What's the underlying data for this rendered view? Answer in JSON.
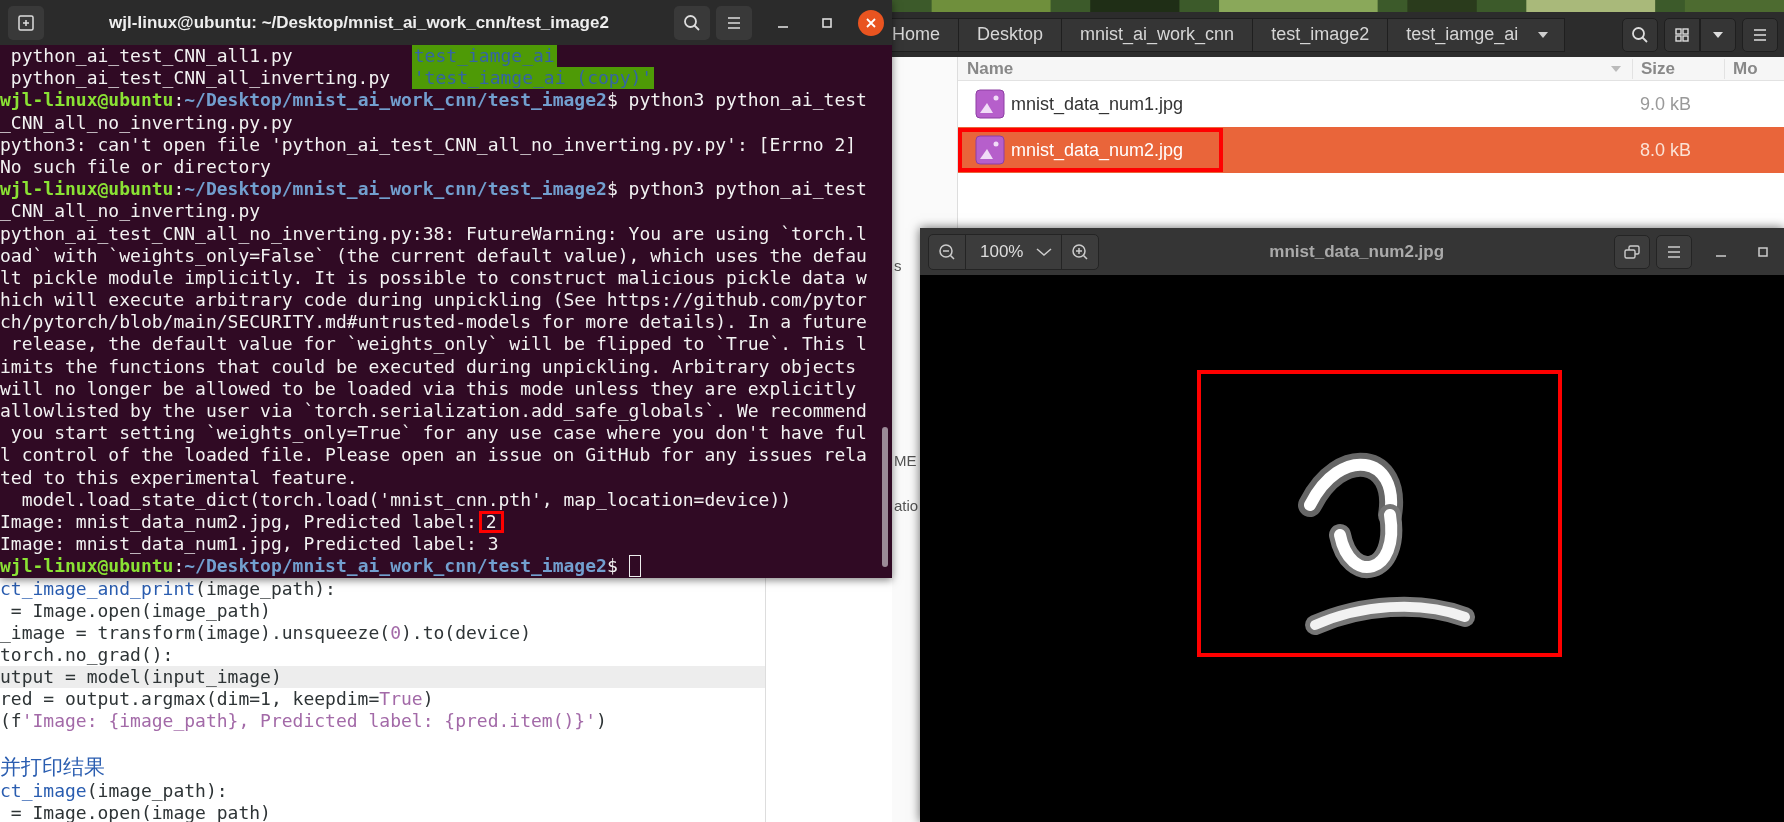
{
  "terminal": {
    "title": "wjl-linux@ubuntu: ~/Desktop/mnist_ai_work_cnn/test_image2",
    "lines": [
      {
        "kind": "ls",
        "file": "python_ai_test_CNN_all1.py",
        "dir": "test_iamge_ai"
      },
      {
        "kind": "ls",
        "file": "python_ai_test_CNN_all_inverting.py",
        "dir": "'test_iamge_ai (copy)'"
      },
      {
        "kind": "prompt",
        "user": "wjl-linux@ubuntu",
        "separator": ":",
        "path": "~/Desktop/mnist_ai_work_cnn/test_image2",
        "sign": "$",
        "command": "python3 python_ai_test",
        "cursor": false
      },
      {
        "kind": "output",
        "text": "_CNN_all_no_inverting.py.py"
      },
      {
        "kind": "output",
        "text": "python3: can't open file 'python_ai_test_CNN_all_no_inverting.py.py': [Errno 2]"
      },
      {
        "kind": "output",
        "text": "No such file or directory"
      },
      {
        "kind": "prompt",
        "user": "wjl-linux@ubuntu",
        "separator": ":",
        "path": "~/Desktop/mnist_ai_work_cnn/test_image2",
        "sign": "$",
        "command": "python3 python_ai_test",
        "cursor": false
      },
      {
        "kind": "output",
        "text": "_CNN_all_no_inverting.py"
      },
      {
        "kind": "output",
        "text": "python_ai_test_CNN_all_no_inverting.py:38: FutureWarning: You are using `torch.l"
      },
      {
        "kind": "output",
        "text": "oad` with `weights_only=False` (the current default value), which uses the defau"
      },
      {
        "kind": "output",
        "text": "lt pickle module implicitly. It is possible to construct malicious pickle data w"
      },
      {
        "kind": "output",
        "text": "hich will execute arbitrary code during unpickling (See https://github.com/pytor"
      },
      {
        "kind": "output",
        "text": "ch/pytorch/blob/main/SECURITY.md#untrusted-models for more details). In a future"
      },
      {
        "kind": "output",
        "text": " release, the default value for `weights_only` will be flipped to `True`. This l"
      },
      {
        "kind": "output",
        "text": "imits the functions that could be executed during unpickling. Arbitrary objects"
      },
      {
        "kind": "output",
        "text": "will no longer be allowed to be loaded via this mode unless they are explicitly"
      },
      {
        "kind": "output",
        "text": "allowlisted by the user via `torch.serialization.add_safe_globals`. We recommend"
      },
      {
        "kind": "output",
        "text": " you start setting `weights_only=True` for any use case where you don't have ful"
      },
      {
        "kind": "output",
        "text": "l control of the loaded file. Please open an issue on GitHub for any issues rela"
      },
      {
        "kind": "output",
        "text": "ted to this experimental feature."
      },
      {
        "kind": "output",
        "text": "  model.load_state_dict(torch.load('mnist_cnn.pth', map_location=device))"
      },
      {
        "kind": "output",
        "text": "Image: mnist_data_num2.jpg, Predicted label:",
        "marked": "2"
      },
      {
        "kind": "output",
        "text": "Image: mnist_data_num1.jpg, Predicted label: 3"
      },
      {
        "kind": "prompt",
        "user": "wjl-linux@ubuntu",
        "separator": ":",
        "path": "~/Desktop/mnist_ai_work_cnn/test_image2",
        "sign": "$",
        "cursor": true
      }
    ]
  },
  "editor": {
    "lines": [
      {
        "kind": "code",
        "current": false,
        "tokens": [
          {
            "text": "ct_image_and_print",
            "kind": "func"
          },
          {
            "text": "(image_path):",
            "kind": "plain"
          }
        ]
      },
      {
        "kind": "code",
        "current": false,
        "tokens": [
          {
            "text": " = Image.open(image_path)",
            "kind": "plain"
          }
        ]
      },
      {
        "kind": "code",
        "current": false,
        "tokens": [
          {
            "text": "_image = transform(image).unsqueeze(",
            "kind": "plain"
          },
          {
            "text": "0",
            "kind": "literal"
          },
          {
            "text": ").to(device)",
            "kind": "plain"
          }
        ]
      },
      {
        "kind": "code",
        "current": false,
        "tokens": [
          {
            "text": "torch.no_grad():",
            "kind": "plain"
          }
        ]
      },
      {
        "kind": "code",
        "current": true,
        "tokens": [
          {
            "text": "utput = model(input_image)",
            "kind": "plain"
          }
        ]
      },
      {
        "kind": "code",
        "current": false,
        "tokens": [
          {
            "text": "red = output.argmax(dim=1, keepdim=",
            "kind": "plain"
          },
          {
            "text": "True",
            "kind": "literal"
          },
          {
            "text": ")",
            "kind": "plain"
          }
        ]
      },
      {
        "kind": "code",
        "current": false,
        "tokens": [
          {
            "text": "(f",
            "kind": "plain"
          },
          {
            "text": "'Image: {image_path}, Predicted label: {pred.item()}'",
            "kind": "literal"
          },
          {
            "text": ")",
            "kind": "plain"
          }
        ]
      },
      {
        "kind": "comment",
        "current": false,
        "tokens": [
          {
            "text": "并打印结果",
            "kind": "func"
          }
        ]
      },
      {
        "kind": "code",
        "current": false,
        "tokens": [
          {
            "text": "ct_image",
            "kind": "func"
          },
          {
            "text": "(image_path):",
            "kind": "plain"
          }
        ]
      },
      {
        "kind": "code",
        "current": false,
        "tokens": [
          {
            "text": " = Image.open(image_path)",
            "kind": "plain"
          }
        ]
      }
    ]
  },
  "file_manager": {
    "breadcrumbs": [
      "Home",
      "Desktop",
      "mnist_ai_work_cnn",
      "test_image2",
      "test_iamge_ai"
    ],
    "sidebar": [
      "s",
      "ME",
      "atio"
    ],
    "columns": [
      "Name",
      "Size",
      "Mo"
    ],
    "files": [
      {
        "name": "mnist_data_num1.jpg",
        "size": "9.0 kB",
        "selected": false,
        "annotated": false
      },
      {
        "name": "mnist_data_num2.jpg",
        "size": "8.0 kB",
        "selected": true,
        "annotated": true
      }
    ]
  },
  "image_viewer": {
    "zoom": "100%",
    "title": "mnist_data_num2.jpg",
    "image": {
      "kind": "picture",
      "annotated": true
    }
  }
}
